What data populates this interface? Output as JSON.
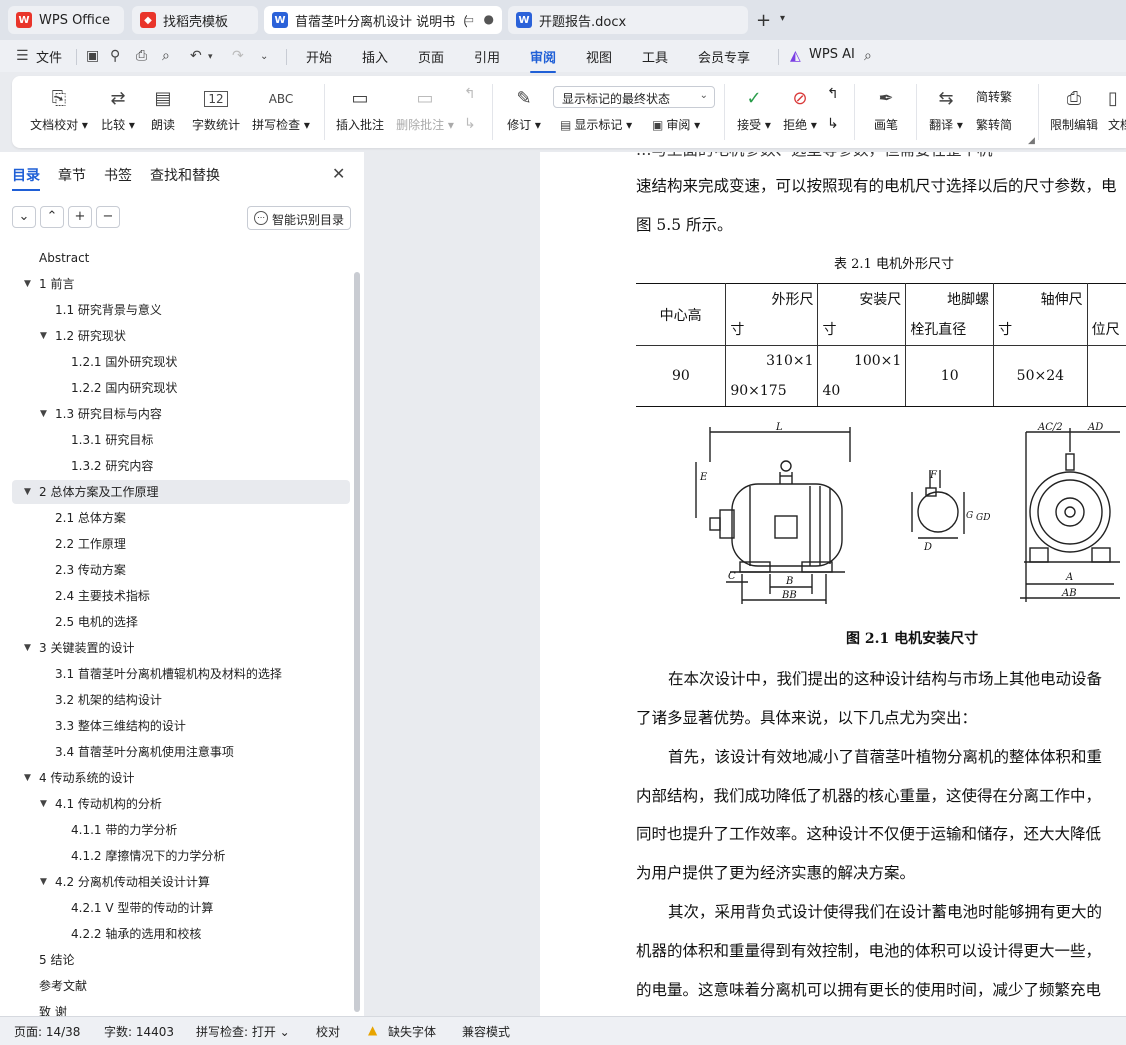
{
  "tabs": [
    {
      "label": "WPS Office",
      "icon": "wps-logo-icon"
    },
    {
      "label": "找稻壳模板",
      "icon": "docer-icon"
    },
    {
      "label": "苜蓿茎叶分离机设计 说明书（",
      "icon": "word-doc-icon",
      "active": true
    },
    {
      "label": "开题报告.docx",
      "icon": "word-doc-icon"
    }
  ],
  "menu": {
    "file": "文件",
    "items": [
      "开始",
      "插入",
      "页面",
      "引用",
      "审阅",
      "视图",
      "工具",
      "会员专享"
    ],
    "active": "审阅",
    "wps_ai": "WPS AI"
  },
  "ribbon": {
    "doc_check": "文档校对",
    "compare": "比较",
    "read_aloud": "朗读",
    "word_count": "字数统计",
    "word_count_icon_text": "12",
    "spell_check": "拼写检查",
    "spell_icon_text": "ABC",
    "insert_comment": "插入批注",
    "delete_comment": "删除批注",
    "track_changes": "修订",
    "markup_state": "显示标记的最终状态",
    "show_markup": "显示标记",
    "review": "审阅",
    "accept": "接受",
    "reject": "拒绝",
    "draw": "画笔",
    "translate": "翻译",
    "to_traditional": "简转繁",
    "to_simplified": "繁转简",
    "restrict_edit": "限制编辑",
    "doc_more": "文档"
  },
  "nav": {
    "tabs": [
      "目录",
      "章节",
      "书签",
      "查找和替换"
    ],
    "active_tab": "目录",
    "smart_toc": "智能识别目录",
    "toc": [
      {
        "label": "Abstract",
        "level": 1,
        "tri": ""
      },
      {
        "label": "1  前言",
        "level": 1,
        "tri": "▼"
      },
      {
        "label": "1.1  研究背景与意义",
        "level": 2,
        "tri": ""
      },
      {
        "label": "1.2  研究现状",
        "level": 2,
        "tri": "▼"
      },
      {
        "label": "1.2.1  国外研究现状",
        "level": 3,
        "tri": ""
      },
      {
        "label": "1.2.2  国内研究现状",
        "level": 3,
        "tri": ""
      },
      {
        "label": "1.3  研究目标与内容",
        "level": 2,
        "tri": "▼"
      },
      {
        "label": "1.3.1  研究目标",
        "level": 3,
        "tri": ""
      },
      {
        "label": "1.3.2  研究内容",
        "level": 3,
        "tri": ""
      },
      {
        "label": "2  总体方案及工作原理",
        "level": 1,
        "tri": "▼",
        "selected": true
      },
      {
        "label": "2.1  总体方案",
        "level": 2,
        "tri": ""
      },
      {
        "label": "2.2  工作原理",
        "level": 2,
        "tri": ""
      },
      {
        "label": "2.3  传动方案",
        "level": 2,
        "tri": ""
      },
      {
        "label": "2.4  主要技术指标",
        "level": 2,
        "tri": ""
      },
      {
        "label": "2.5  电机的选择",
        "level": 2,
        "tri": ""
      },
      {
        "label": "3 关键装置的设计",
        "level": 1,
        "tri": "▼"
      },
      {
        "label": "3.1 苜蓿茎叶分离机槽辊机构及材料的选择",
        "level": 2,
        "tri": ""
      },
      {
        "label": "3.2  机架的结构设计",
        "level": 2,
        "tri": ""
      },
      {
        "label": "3.3  整体三维结构的设计",
        "level": 2,
        "tri": ""
      },
      {
        "label": "3.4  苜蓿茎叶分离机使用注意事项",
        "level": 2,
        "tri": ""
      },
      {
        "label": "4  传动系统的设计",
        "level": 1,
        "tri": "▼"
      },
      {
        "label": "4.1  传动机构的分析",
        "level": 2,
        "tri": "▼"
      },
      {
        "label": "4.1.1  带的力学分析",
        "level": 3,
        "tri": ""
      },
      {
        "label": "4.1.2  摩擦情况下的力学分析",
        "level": 3,
        "tri": ""
      },
      {
        "label": "4.2  分离机传动相关设计计算",
        "level": 2,
        "tri": "▼"
      },
      {
        "label": "4.2.1 V 型带的传动的计算",
        "level": 3,
        "tri": ""
      },
      {
        "label": "4.2.2  轴承的选用和校核",
        "level": 3,
        "tri": ""
      },
      {
        "label": "5  结论",
        "level": 1,
        "tri": ""
      },
      {
        "label": "参考文献",
        "level": 1,
        "tri": ""
      },
      {
        "label": "致    谢",
        "level": 1,
        "tri": ""
      }
    ]
  },
  "doc": {
    "para_top": "…与上面的电机参数、选型等参数，但需要在整个机",
    "line1": "速结构来完成变速，可以按照现有的电机尺寸选择以后的尺寸参数，电",
    "line2": "图 5.5 所示。",
    "table_caption": "表 2.1  电机外形尺寸",
    "table_header": [
      "中心高",
      "外形尺|寸",
      "安装尺|寸",
      "地脚螺|栓孔直径",
      "轴伸尺|寸",
      "|位"
    ],
    "table_row": [
      "90",
      "310×1|90×175",
      "100×1|40",
      "10",
      "50×24",
      ""
    ],
    "figure_caption": "图 2.1 电机安装尺寸",
    "paragraphs": [
      "在本次设计中，我们提出的这种设计结构与市场上其他电动设备",
      "了诸多显著优势。具体来说，以下几点尤为突出：",
      "首先，该设计有效地减小了苜蓿茎叶植物分离机的整体体积和重",
      "内部结构，我们成功降低了机器的核心重量，这使得在分离工作中，",
      "同时也提升了工作效率。这种设计不仅便于运输和储存，还大大降低",
      "为用户提供了更为经济实惠的解决方案。",
      "其次，采用背负式设计使得我们在设计蓄电池时能够拥有更大的",
      "机器的体积和重量得到有效控制，电池的体积可以设计得更大一些，",
      "的电量。这意味着分离机可以拥有更长的使用时间，减少了频繁充电"
    ],
    "fig_labels": {
      "L": "L",
      "E": "E",
      "C": "C",
      "B": "B",
      "BB": "BB",
      "F": "F",
      "D": "D",
      "G": "G",
      "GD": "GD",
      "AC2": "AC/2",
      "AD": "AD",
      "A": "A",
      "AB": "AB"
    }
  },
  "status": {
    "page": "页面: 14/38",
    "words": "字数: 14403",
    "spell": "拼写检查: 打开",
    "proof": "校对",
    "missing_font": "缺失字体",
    "compat": "兼容模式"
  }
}
